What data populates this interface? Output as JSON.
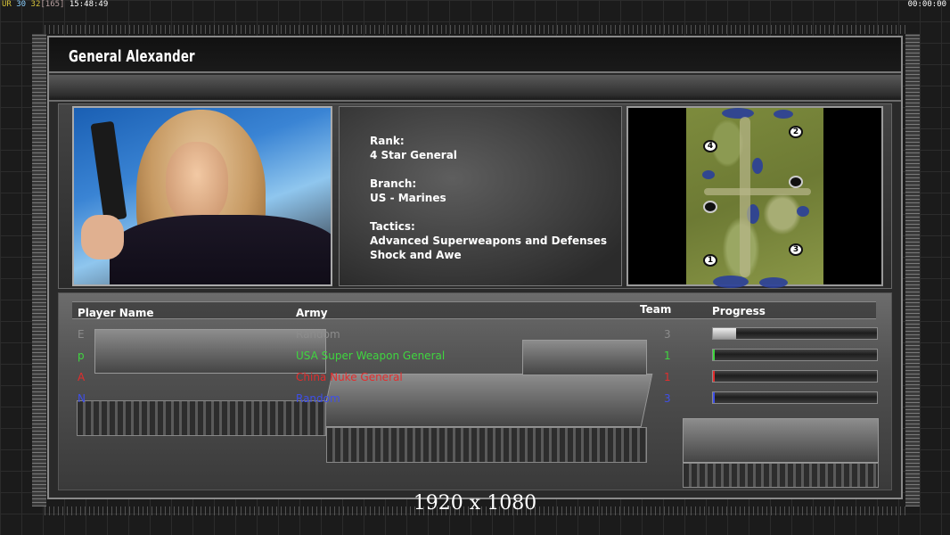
{
  "hud": {
    "fps_a": "UR",
    "fps_b": "30",
    "fps_c": "32",
    "fps_d": "[165]",
    "clock": "15:48:49",
    "timer": "00:00:00"
  },
  "general": {
    "title": "General Alexander",
    "rank_label": "Rank:",
    "rank_value": "4 Star General",
    "branch_label": "Branch:",
    "branch_value": "US - Marines",
    "tactics_label": "Tactics:",
    "tactics_line1": "Advanced Superweapons and Defenses",
    "tactics_line2": "Shock and Awe"
  },
  "map": {
    "spawns": [
      "4",
      "2",
      "1",
      "3"
    ]
  },
  "players_table": {
    "headers": {
      "name": "Player Name",
      "army": "Army",
      "team": "Team",
      "progress": "Progress"
    },
    "rows": [
      {
        "name": "E",
        "army": "Random",
        "team": "3",
        "color": "#8c8c8c",
        "progress": 0.14
      },
      {
        "name": "p",
        "army": "USA Super Weapon General",
        "team": "1",
        "color": "#3fd63f",
        "progress": 0.01
      },
      {
        "name": "A",
        "army": "China Nuke General",
        "team": "1",
        "color": "#e22d2d",
        "progress": 0.01
      },
      {
        "name": "N",
        "army": "Random",
        "team": "3",
        "color": "#3f4fe8",
        "progress": 0.01
      }
    ]
  },
  "caption": "1920 x 1080"
}
